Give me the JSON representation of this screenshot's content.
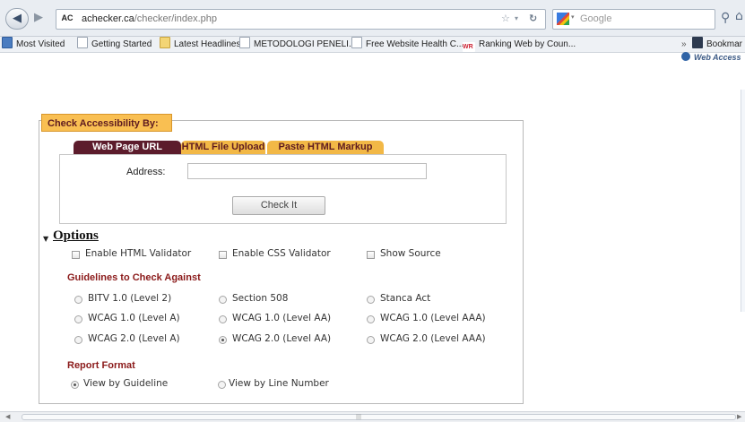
{
  "browser": {
    "url_domain": "achecker.ca",
    "url_path": "/checker/index.php",
    "site_badge": "AC",
    "search_placeholder": "Google",
    "back_icon": "back-arrow-icon",
    "forward_icon": "forward-arrow-icon"
  },
  "bookmarks": [
    "Most Visited",
    "Getting Started",
    "Latest Headlines",
    "METODOLOGI PENELI...",
    "Free Website Health C...",
    "Ranking Web by Coun..."
  ],
  "bookmarks_more": "»",
  "bookmarks_menu": "Bookmar",
  "web_access_strip": "Web Access",
  "form": {
    "legend": "Check Accessibility By:",
    "tabs": [
      "Web Page URL",
      "HTML File Upload",
      "Paste HTML Markup"
    ],
    "active_tab": "Web Page URL",
    "address_label": "Address:",
    "address_value": "",
    "check_button": "Check It"
  },
  "options": {
    "title": "Options",
    "validators": [
      {
        "label": "Enable HTML Validator",
        "checked": false
      },
      {
        "label": "Enable CSS Validator",
        "checked": false
      },
      {
        "label": "Show Source",
        "checked": false
      }
    ],
    "guidelines_heading": "Guidelines to Check Against",
    "guidelines": [
      {
        "label": "BITV 1.0 (Level 2)",
        "selected": false
      },
      {
        "label": "Section 508",
        "selected": false
      },
      {
        "label": "Stanca Act",
        "selected": false
      },
      {
        "label": "WCAG 1.0 (Level A)",
        "selected": false
      },
      {
        "label": "WCAG 1.0 (Level AA)",
        "selected": false
      },
      {
        "label": "WCAG 1.0 (Level AAA)",
        "selected": false
      },
      {
        "label": "WCAG 2.0 (Level A)",
        "selected": false
      },
      {
        "label": "WCAG 2.0 (Level AA)",
        "selected": true
      },
      {
        "label": "WCAG 2.0 (Level AAA)",
        "selected": false
      }
    ],
    "report_heading": "Report Format",
    "report_formats": [
      {
        "label": "View by Guideline",
        "selected": true
      },
      {
        "label": "View by Line Number",
        "selected": false
      }
    ]
  },
  "colors": {
    "legend_bg": "#f9bf52",
    "active_tab": "#5c1c2c",
    "inactive_tab": "#f2b846",
    "section_heading": "#8b1a1a"
  }
}
